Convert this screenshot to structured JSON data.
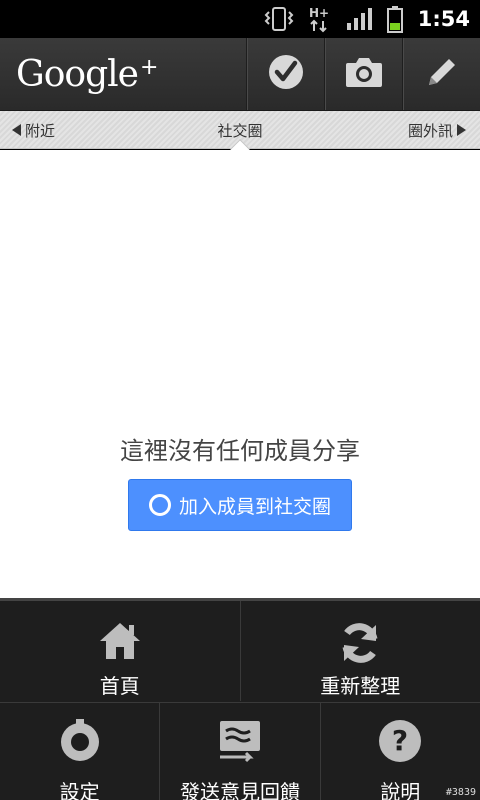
{
  "status_bar": {
    "time": "1:54",
    "network_type": "H+"
  },
  "action_bar": {
    "logo_text": "Google",
    "logo_plus": "+",
    "buttons": [
      {
        "icon": "checkin-icon"
      },
      {
        "icon": "camera-icon"
      },
      {
        "icon": "pencil-icon"
      }
    ]
  },
  "nav": {
    "left_label": "附近",
    "center_label": "社交圈",
    "right_label": "圈外訊"
  },
  "content": {
    "empty_message": "這裡沒有任何成員分享",
    "add_button_label": "加入成員到社交圈"
  },
  "menu": {
    "row1": [
      {
        "label": "首頁",
        "icon": "home-icon"
      },
      {
        "label": "重新整理",
        "icon": "refresh-icon"
      }
    ],
    "row2": [
      {
        "label": "設定",
        "icon": "settings-icon"
      },
      {
        "label": "發送意見回饋",
        "icon": "feedback-icon"
      },
      {
        "label": "說明",
        "icon": "help-icon"
      }
    ]
  },
  "watermark": "#3839",
  "colors": {
    "accent": "#4d90fe",
    "actionbar": "#2f2f2f",
    "menu_bg": "#1e1e1e"
  }
}
